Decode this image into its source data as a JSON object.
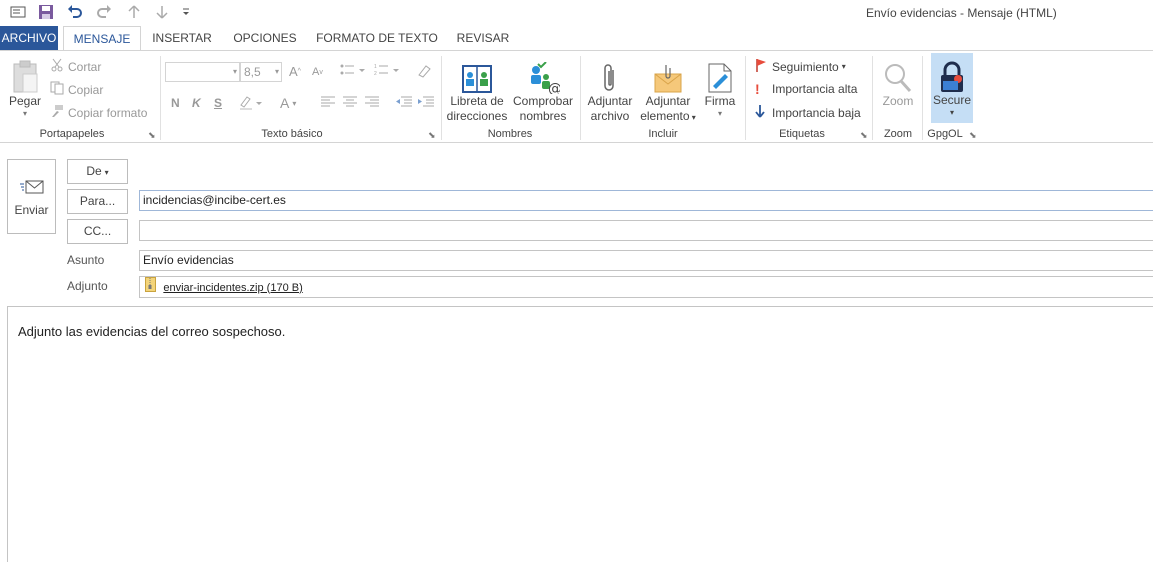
{
  "window": {
    "title": "Envío evidencias - Mensaje (HTML)"
  },
  "tabs": [
    {
      "label": "ARCHIVO"
    },
    {
      "label": "MENSAJE"
    },
    {
      "label": "INSERTAR"
    },
    {
      "label": "OPCIONES"
    },
    {
      "label": "FORMATO DE TEXTO"
    },
    {
      "label": "REVISAR"
    }
  ],
  "ribbon": {
    "portapapeles": {
      "label": "Portapapeles",
      "paste": "Pegar",
      "cut": "Cortar",
      "copy": "Copiar",
      "format_painter": "Copiar formato"
    },
    "texto_basico": {
      "label": "Texto básico",
      "font_size": "8,5",
      "bold": "N",
      "italic": "K",
      "underline": "S"
    },
    "nombres": {
      "label": "Nombres",
      "address_book_1": "Libreta de",
      "address_book_2": "direcciones",
      "check_names_1": "Comprobar",
      "check_names_2": "nombres"
    },
    "incluir": {
      "label": "Incluir",
      "attach_file_1": "Adjuntar",
      "attach_file_2": "archivo",
      "attach_item_1": "Adjuntar",
      "attach_item_2": "elemento",
      "signature": "Firma"
    },
    "etiquetas": {
      "label": "Etiquetas",
      "follow_up": "Seguimiento",
      "high_importance": "Importancia alta",
      "low_importance": "Importancia baja"
    },
    "zoom": {
      "label": "Zoom",
      "zoom": "Zoom"
    },
    "gpgol": {
      "label": "GpgOL",
      "secure": "Secure"
    }
  },
  "header": {
    "send": "Enviar",
    "from": "De",
    "to_button": "Para...",
    "to_value": "incidencias@incibe-cert.es",
    "cc_button": "CC...",
    "cc_value": "",
    "subject_label": "Asunto",
    "subject_value": "Envío evidencias",
    "attach_label": "Adjunto",
    "attach_value": "enviar-incidentes.zip (170 B)"
  },
  "body": {
    "text": "Adjunto las evidencias del correo sospechoso."
  },
  "colors": {
    "accent": "#2b579a",
    "secure_bg": "#c5def5"
  }
}
